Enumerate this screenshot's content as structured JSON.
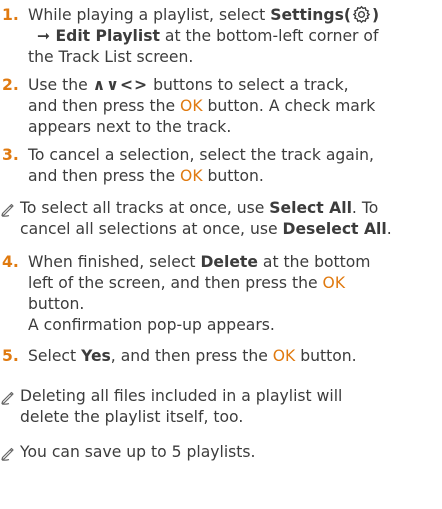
{
  "steps": [
    {
      "number": "1.",
      "line1_pre": "While playing a playlist, select ",
      "line1_bold": "Settings(",
      "line1_bold_close": ")",
      "line2_arrow": "➞ ",
      "line2_bold": "Edit Playlist",
      "line2_rest": " at the bottom-left corner of",
      "line3": "the Track List screen."
    },
    {
      "number": "2.",
      "line1_pre": "Use the ",
      "line1_glyphs": "∧∨<>",
      "line1_post": " buttons to select a track,",
      "line2_pre": "and then press the ",
      "line2_ok": "OK",
      "line2_post": " button. A check mark",
      "line3": "appears next to the track."
    },
    {
      "number": "3.",
      "line1": "To cancel a selection, select the track again,",
      "line2_pre": "and then press the ",
      "line2_ok": "OK",
      "line2_post": " button."
    }
  ],
  "note1": {
    "icon": "pencil-note-icon",
    "line1_pre": "To select all tracks at once, use ",
    "line1_bold": "Select All",
    "line1_post": ". To",
    "line2_pre": "cancel all selections at once, use ",
    "line2_bold": "Deselect All",
    "line2_post": "."
  },
  "steps_b": [
    {
      "number": "4.",
      "line1_pre": "When finished, select ",
      "line1_bold": "Delete",
      "line1_post": " at the bottom",
      "line2_pre": "left of the screen, and then press the ",
      "line2_ok": "OK",
      "line3": "button.",
      "line4": "A confirmation pop-up appears."
    },
    {
      "number": "5.",
      "line1_pre": "Select ",
      "line1_bold": "Yes",
      "line1_mid": ", and then press the ",
      "line1_ok": "OK",
      "line1_post": " button."
    }
  ],
  "note2": {
    "icon": "pencil-note-icon",
    "line1": "Deleting all files included in a playlist will",
    "line2": "delete the playlist itself, too."
  },
  "note3": {
    "icon": "pencil-note-icon",
    "line1": "You can save up to 5 playlists."
  },
  "colors": {
    "text": "#3c3c3c",
    "accent": "#e07a10"
  }
}
